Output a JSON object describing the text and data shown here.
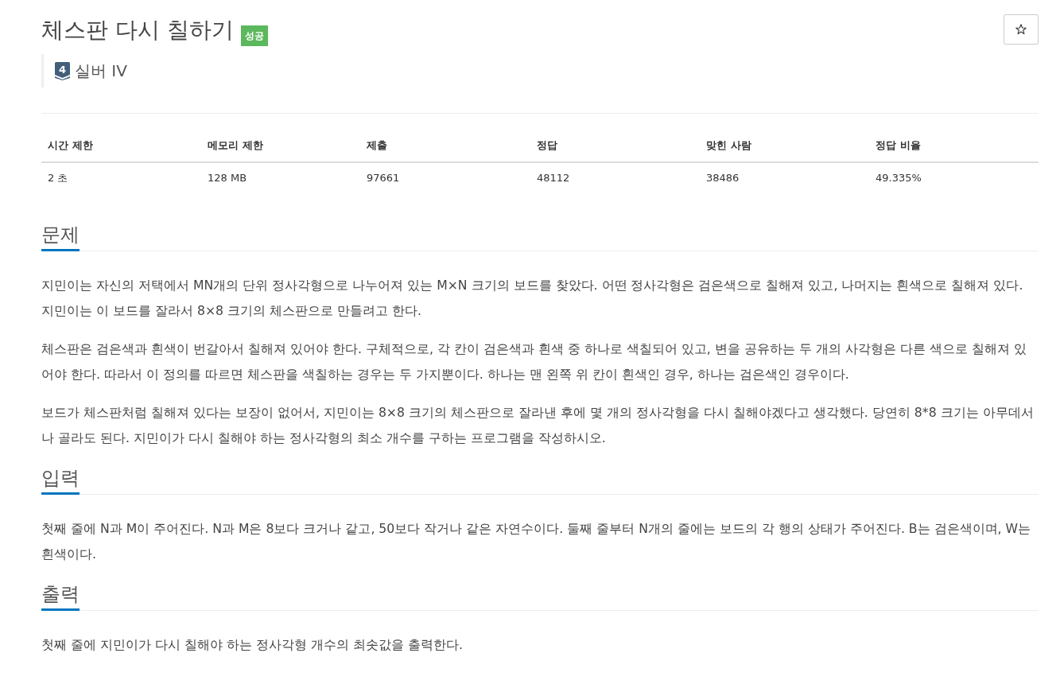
{
  "header": {
    "title": "체스판 다시 칠하기",
    "status": {
      "label": "성공",
      "kind": "success"
    },
    "favorite_button": {
      "starred": false
    }
  },
  "tier": {
    "kind": "silver",
    "number": "4",
    "label": "실버 IV"
  },
  "info_table": {
    "columns": [
      "시간 제한",
      "메모리 제한",
      "제출",
      "정답",
      "맞힌 사람",
      "정답 비율"
    ],
    "rows": [
      [
        "2 초",
        "128 MB",
        "97661",
        "48112",
        "38486",
        "49.335%"
      ]
    ]
  },
  "sections": [
    {
      "heading": "문제",
      "paragraphs": [
        "지민이는 자신의 저택에서 MN개의 단위 정사각형으로 나누어져 있는 M×N 크기의 보드를 찾았다. 어떤 정사각형은 검은색으로 칠해져 있고, 나머지는 흰색으로 칠해져 있다. 지민이는 이 보드를 잘라서 8×8 크기의 체스판으로 만들려고 한다.",
        "체스판은 검은색과 흰색이 번갈아서 칠해져 있어야 한다. 구체적으로, 각 칸이 검은색과 흰색 중 하나로 색칠되어 있고, 변을 공유하는 두 개의 사각형은 다른 색으로 칠해져 있어야 한다. 따라서 이 정의를 따르면 체스판을 색칠하는 경우는 두 가지뿐이다. 하나는 맨 왼쪽 위 칸이 흰색인 경우, 하나는 검은색인 경우이다.",
        "보드가 체스판처럼 칠해져 있다는 보장이 없어서, 지민이는 8×8 크기의 체스판으로 잘라낸 후에 몇 개의 정사각형을 다시 칠해야겠다고 생각했다. 당연히 8*8 크기는 아무데서나 골라도 된다. 지민이가 다시 칠해야 하는 정사각형의 최소 개수를 구하는 프로그램을 작성하시오."
      ]
    },
    {
      "heading": "입력",
      "paragraphs": [
        "첫째 줄에 N과 M이 주어진다. N과 M은 8보다 크거나 같고, 50보다 작거나 같은 자연수이다. 둘째 줄부터 N개의 줄에는 보드의 각 행의 상태가 주어진다. B는 검은색이며, W는 흰색이다."
      ]
    },
    {
      "heading": "출력",
      "paragraphs": [
        "첫째 줄에 지민이가 다시 칠해야 하는 정사각형 개수의 최솟값을 출력한다."
      ]
    }
  ]
}
